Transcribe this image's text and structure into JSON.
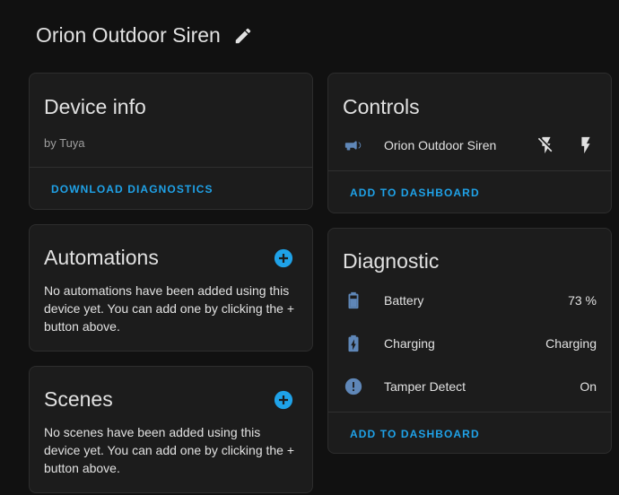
{
  "header": {
    "title": "Orion Outdoor Siren"
  },
  "device_info": {
    "title": "Device info",
    "manufacturer": "by Tuya",
    "download_label": "DOWNLOAD DIAGNOSTICS"
  },
  "automations": {
    "title": "Automations",
    "empty_text": "No automations have been added using this device yet. You can add one by clicking the + button above."
  },
  "scenes": {
    "title": "Scenes",
    "empty_text": "No scenes have been added using this device yet. You can add one by clicking the + button above."
  },
  "controls": {
    "title": "Controls",
    "entity_name": "Orion Outdoor Siren",
    "add_label": "ADD TO DASHBOARD"
  },
  "diagnostic": {
    "title": "Diagnostic",
    "rows": [
      {
        "label": "Battery",
        "value": "73 %",
        "icon": "battery-icon"
      },
      {
        "label": "Charging",
        "value": "Charging",
        "icon": "battery-charging-icon"
      },
      {
        "label": "Tamper Detect",
        "value": "On",
        "icon": "alert-circle-icon"
      }
    ],
    "add_label": "ADD TO DASHBOARD"
  },
  "colors": {
    "accent": "#1fa2e8",
    "icon": "#5f87b8",
    "background": "#111111",
    "card": "#1c1c1c"
  }
}
